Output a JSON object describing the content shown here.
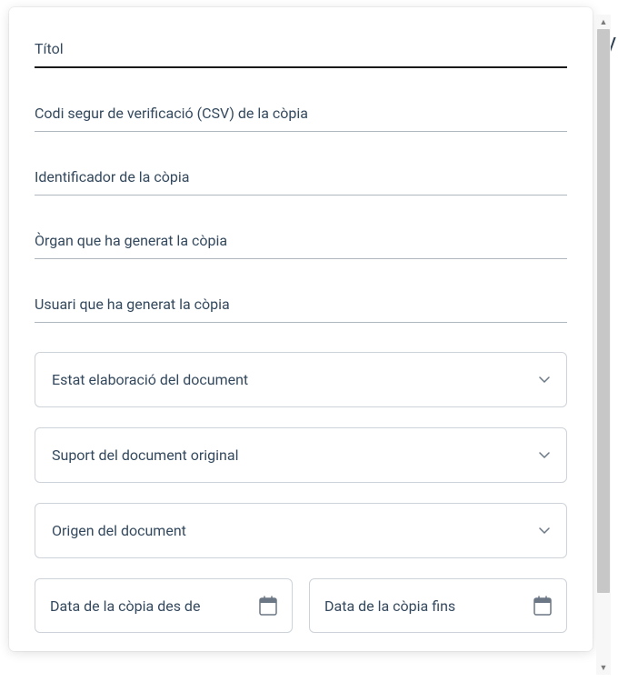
{
  "fields": {
    "title": {
      "placeholder": "Títol"
    },
    "csv": {
      "placeholder": "Codi segur de verificació (CSV) de la còpia"
    },
    "identifier": {
      "placeholder": "Identificador de la còpia"
    },
    "organ": {
      "placeholder": "Òrgan que ha generat la còpia"
    },
    "user": {
      "placeholder": "Usuari que ha generat la còpia"
    }
  },
  "selects": {
    "estat": {
      "label": "Estat elaboració del document"
    },
    "suport": {
      "label": "Suport del document original"
    },
    "origen": {
      "label": "Origen del document"
    }
  },
  "dates": {
    "from": {
      "label": "Data de la còpia des de"
    },
    "to": {
      "label": "Data de la còpia fins"
    }
  },
  "background": {
    "partial_letter": "V"
  }
}
